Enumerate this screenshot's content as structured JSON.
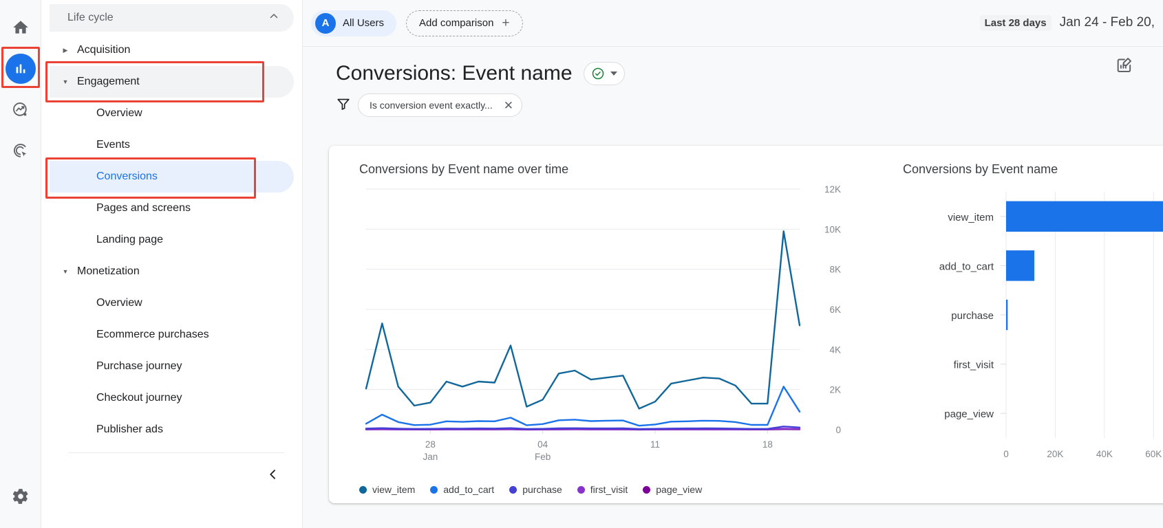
{
  "rail": {
    "items": [
      {
        "name": "home-icon",
        "label": "Home"
      },
      {
        "name": "reports-icon",
        "label": "Reports"
      },
      {
        "name": "explore-icon",
        "label": "Explore"
      },
      {
        "name": "advertising-icon",
        "label": "Advertising"
      }
    ],
    "settings_label": "Admin",
    "active_index": 1,
    "active_color": "#1a73e8",
    "highlight_color": "#ea4335"
  },
  "sidebar": {
    "group_title": "Life cycle",
    "collapse_label": "‹",
    "items": [
      {
        "label": "Acquisition",
        "level": "top",
        "state": "collapsed"
      },
      {
        "label": "Engagement",
        "level": "top",
        "state": "expanded"
      },
      {
        "label": "Overview",
        "level": "child",
        "state": "none"
      },
      {
        "label": "Events",
        "level": "child",
        "state": "none"
      },
      {
        "label": "Conversions",
        "level": "child",
        "state": "selected"
      },
      {
        "label": "Pages and screens",
        "level": "child",
        "state": "none"
      },
      {
        "label": "Landing page",
        "level": "child",
        "state": "none"
      },
      {
        "label": "Monetization",
        "level": "top",
        "state": "expanded"
      },
      {
        "label": "Overview",
        "level": "child",
        "state": "none"
      },
      {
        "label": "Ecommerce purchases",
        "level": "child",
        "state": "none"
      },
      {
        "label": "Purchase journey",
        "level": "child",
        "state": "none"
      },
      {
        "label": "Checkout journey",
        "level": "child",
        "state": "none"
      },
      {
        "label": "Publisher ads",
        "level": "child",
        "state": "none"
      }
    ]
  },
  "topbar": {
    "segment_initial": "A",
    "segment_label": "All Users",
    "add_comparison_label": "Add comparison",
    "date_preset": "Last 28 days",
    "date_range": "Jan 24 - Feb 20,"
  },
  "header": {
    "title": "Conversions: Event name",
    "filter_label": "Is conversion event exactly...",
    "close_glyph": "✕"
  },
  "chart_data": [
    {
      "type": "line",
      "title": "Conversions by Event name over time",
      "xlabel": "",
      "ylabel": "",
      "ylim": [
        0,
        12000
      ],
      "yticks": [
        0,
        2000,
        4000,
        6000,
        8000,
        10000,
        12000
      ],
      "ytick_labels": [
        "0",
        "2K",
        "4K",
        "6K",
        "8K",
        "10K",
        "12K"
      ],
      "grid": true,
      "legend_position": "bottom",
      "x": [
        "Jan 24",
        "Jan 25",
        "Jan 26",
        "Jan 27",
        "Jan 28",
        "Jan 29",
        "Jan 30",
        "Jan 31",
        "Feb 01",
        "Feb 02",
        "Feb 03",
        "Feb 04",
        "Feb 05",
        "Feb 06",
        "Feb 07",
        "Feb 08",
        "Feb 09",
        "Feb 10",
        "Feb 11",
        "Feb 12",
        "Feb 13",
        "Feb 14",
        "Feb 15",
        "Feb 16",
        "Feb 17",
        "Feb 18",
        "Feb 19",
        "Feb 20"
      ],
      "xtick_positions": [
        4,
        11,
        18,
        25
      ],
      "xtick_labels": [
        [
          "28",
          "Jan"
        ],
        [
          "04",
          "Feb"
        ],
        [
          "11",
          ""
        ],
        [
          "18",
          ""
        ]
      ],
      "series": [
        {
          "name": "view_item",
          "color": "#11679a",
          "values": [
            2050,
            5300,
            2150,
            1200,
            1350,
            2400,
            2150,
            2400,
            2350,
            4200,
            1150,
            1500,
            2800,
            2950,
            2500,
            2600,
            2700,
            1050,
            1400,
            2300,
            2450,
            2600,
            2550,
            2200,
            1300,
            1300,
            9900,
            5200
          ]
        },
        {
          "name": "add_to_cart",
          "color": "#1a73e8",
          "values": [
            300,
            750,
            380,
            230,
            250,
            420,
            390,
            430,
            420,
            600,
            220,
            280,
            470,
            500,
            430,
            450,
            460,
            200,
            260,
            400,
            420,
            450,
            440,
            380,
            240,
            240,
            2150,
            900
          ]
        },
        {
          "name": "purchase",
          "color": "#4340d6",
          "values": [
            60,
            80,
            55,
            40,
            45,
            60,
            55,
            65,
            60,
            80,
            35,
            45,
            70,
            75,
            65,
            65,
            70,
            35,
            45,
            60,
            65,
            70,
            65,
            55,
            40,
            40,
            160,
            110
          ]
        },
        {
          "name": "first_visit",
          "color": "#8833cc",
          "values": [
            20,
            25,
            18,
            12,
            14,
            20,
            18,
            20,
            19,
            26,
            11,
            14,
            22,
            24,
            20,
            21,
            22,
            11,
            14,
            19,
            20,
            22,
            21,
            18,
            13,
            13,
            50,
            35
          ]
        },
        {
          "name": "page_view",
          "color": "#7b0099",
          "values": [
            10,
            12,
            9,
            6,
            7,
            10,
            9,
            10,
            9,
            13,
            5,
            7,
            11,
            12,
            10,
            10,
            11,
            5,
            7,
            9,
            10,
            11,
            10,
            9,
            6,
            6,
            25,
            17
          ]
        }
      ]
    },
    {
      "type": "bar",
      "orientation": "horizontal",
      "title": "Conversions by Event name",
      "categories": [
        "view_item",
        "add_to_cart",
        "purchase",
        "first_visit",
        "page_view"
      ],
      "values": [
        66000,
        11500,
        650,
        0,
        0
      ],
      "bar_color": "#1a73e8",
      "xlim": [
        0,
        70000
      ],
      "xticks": [
        0,
        20000,
        40000,
        60000
      ],
      "xtick_labels": [
        "0",
        "20K",
        "40K",
        "60K"
      ],
      "grid": true,
      "ylabel": "",
      "xlabel": ""
    }
  ]
}
